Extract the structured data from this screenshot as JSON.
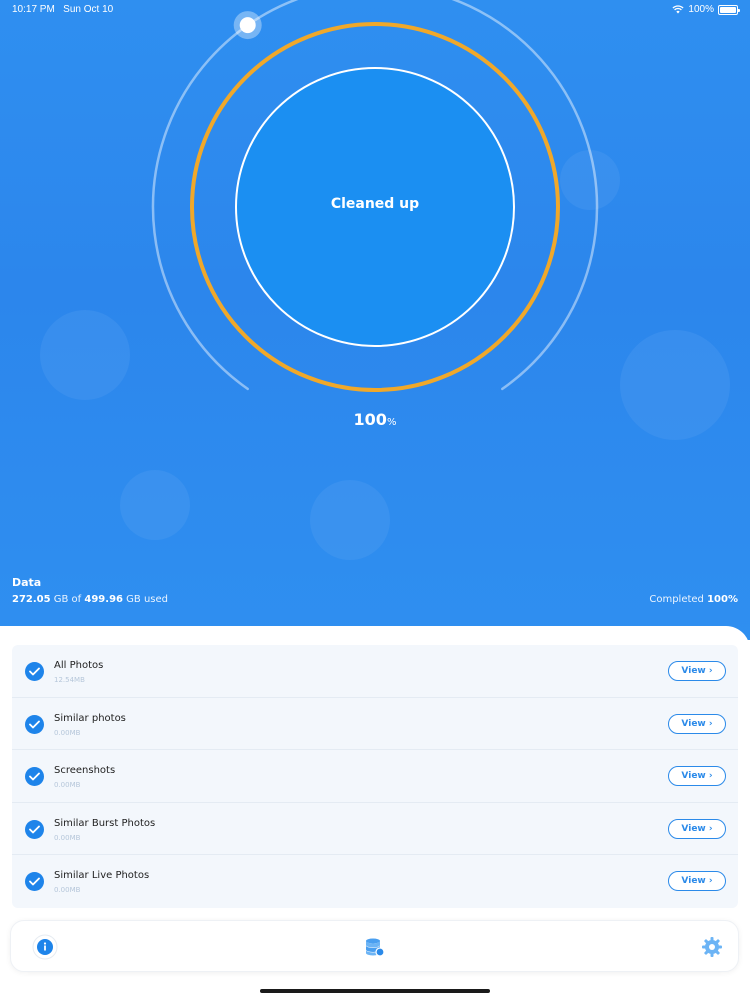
{
  "status_bar": {
    "time": "10:17 PM",
    "date": "Sun Oct 10",
    "battery": "100%",
    "icons": [
      "wifi-icon",
      "battery-icon"
    ]
  },
  "gauge": {
    "label": "Cleaned up",
    "percent_value": "100",
    "percent_unit": "%",
    "progress": 1.0
  },
  "data_section": {
    "title": "Data",
    "used": "272.05",
    "used_unit": " GB of ",
    "total": "499.96",
    "total_unit": " GB used",
    "completed_label": "Completed ",
    "completed_value": "100%"
  },
  "items": [
    {
      "name": "All Photos",
      "size": "12.54MB",
      "button": "View ›"
    },
    {
      "name": "Similar photos",
      "size": "0.00MB",
      "button": "View ›"
    },
    {
      "name": "Screenshots",
      "size": "0.00MB",
      "button": "View ›"
    },
    {
      "name": "Similar Burst Photos",
      "size": "0.00MB",
      "button": "View ›"
    },
    {
      "name": "Similar Live Photos",
      "size": "0.00MB",
      "button": "View ›"
    }
  ],
  "tabs": [
    {
      "icon": "info-icon"
    },
    {
      "icon": "database-icon"
    },
    {
      "icon": "gear-icon"
    }
  ],
  "colors": {
    "primary": "#2f8ff0",
    "ring_orange": "#f0a82a",
    "accent_blue": "#1e84ea"
  }
}
